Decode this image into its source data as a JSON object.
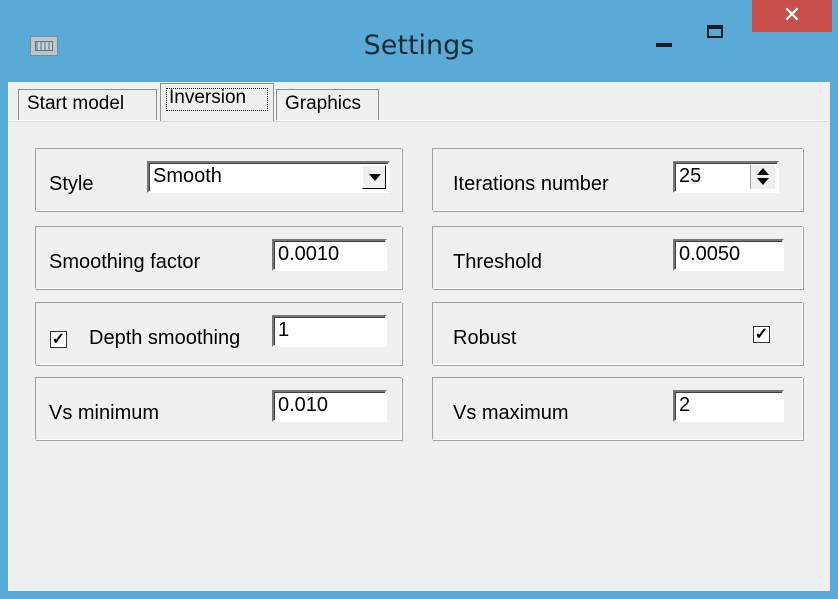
{
  "window": {
    "title": "Settings",
    "close_glyph": "✕"
  },
  "tabs": [
    {
      "label": "Start model",
      "active": false
    },
    {
      "label": "Inversion",
      "active": true
    },
    {
      "label": "Graphics",
      "active": false
    }
  ],
  "inversion": {
    "style": {
      "label": "Style",
      "value": "Smooth"
    },
    "iterations": {
      "label": "Iterations number",
      "value": "25"
    },
    "smoothing_factor": {
      "label": "Smoothing factor",
      "value": "0.0010"
    },
    "threshold": {
      "label": "Threshold",
      "value": "0.0050"
    },
    "depth_smoothing": {
      "label": "Depth smoothing",
      "checked": true,
      "check_glyph": "✓",
      "value": "1"
    },
    "robust": {
      "label": "Robust",
      "checked": true,
      "check_glyph": "✓"
    },
    "vs_minimum": {
      "label": "Vs minimum",
      "value": "0.010"
    },
    "vs_maximum": {
      "label": "Vs maximum",
      "value": "2"
    }
  }
}
